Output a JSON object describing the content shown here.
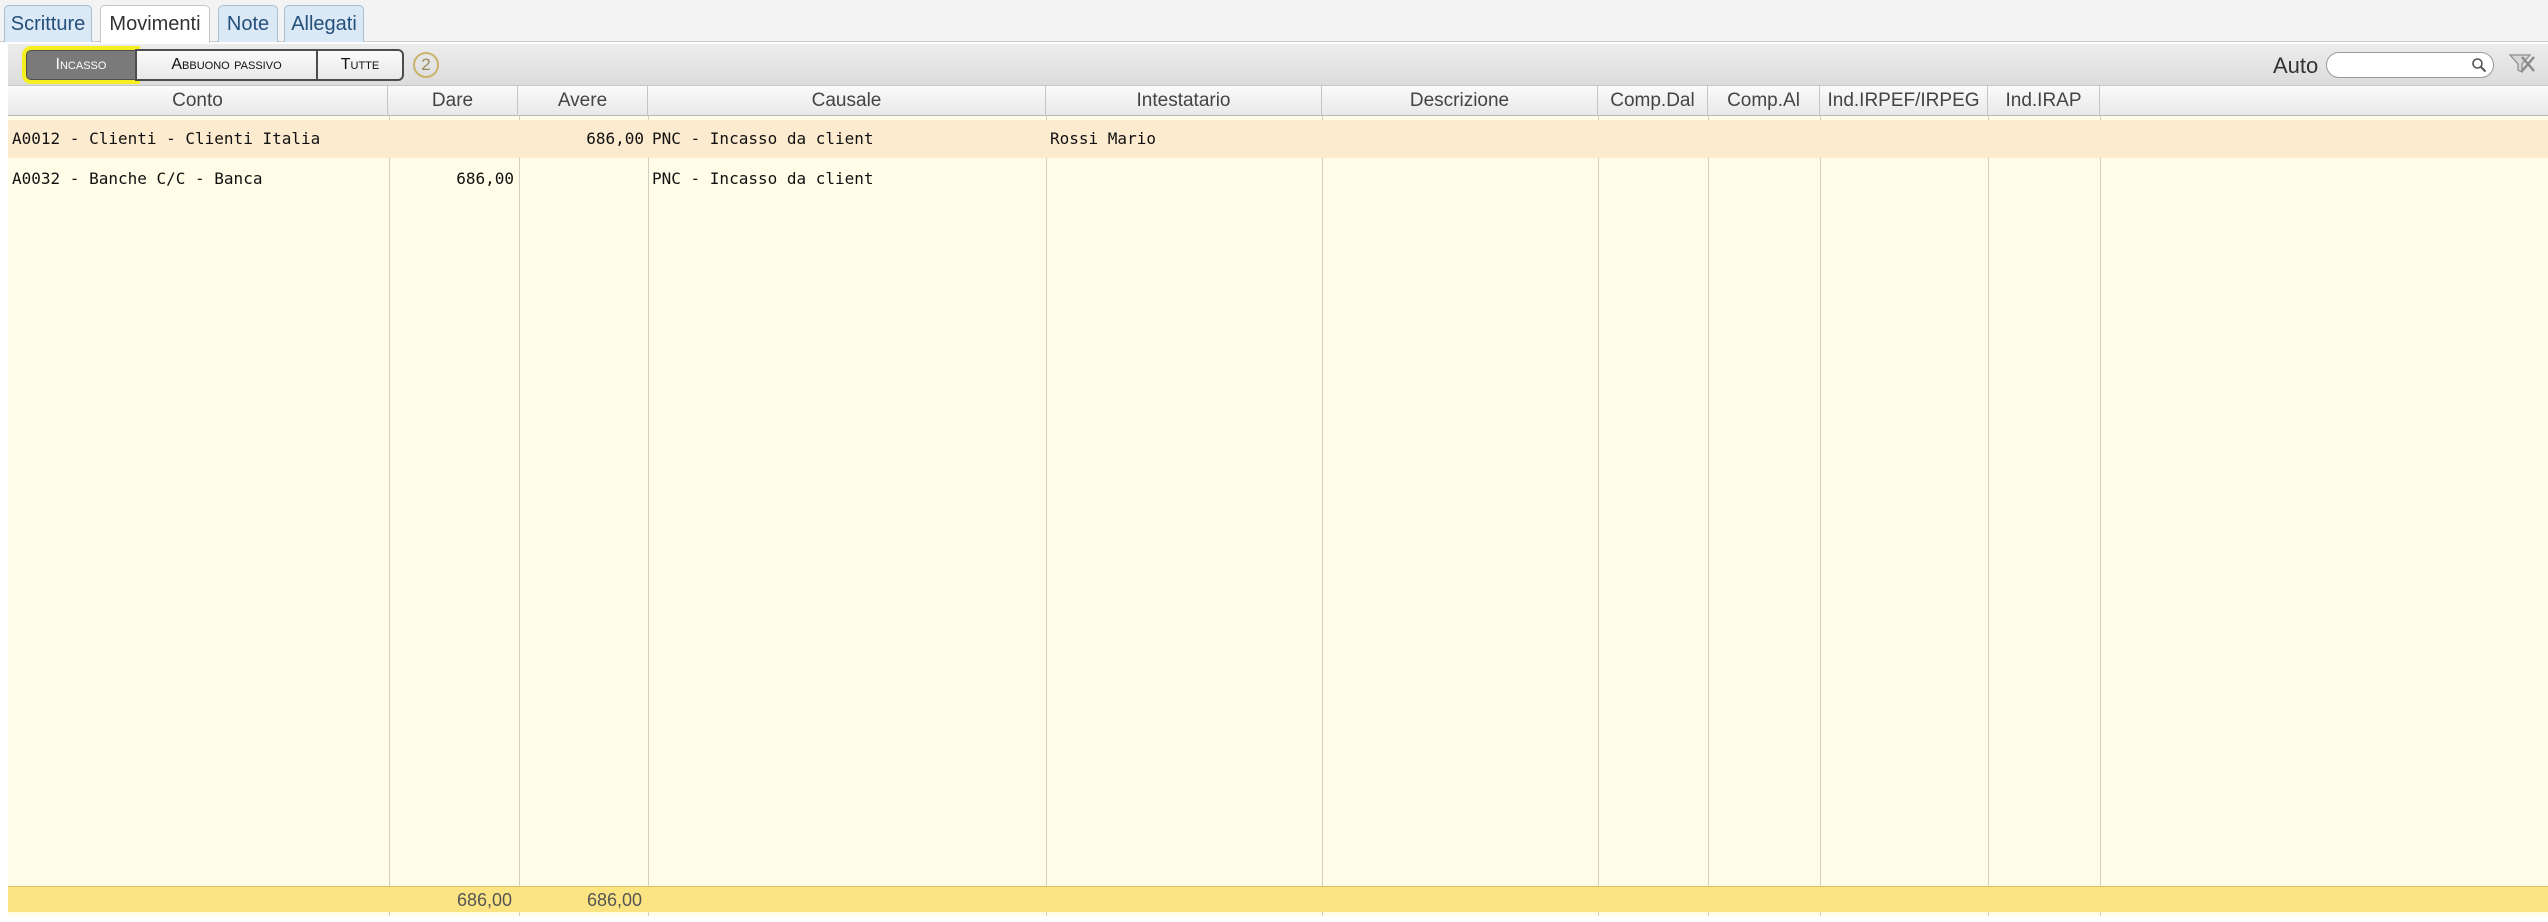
{
  "tabs": [
    {
      "label": "Scritture",
      "active": false
    },
    {
      "label": "Movimenti",
      "active": true
    },
    {
      "label": "Note",
      "active": false
    },
    {
      "label": "Allegati",
      "active": false
    }
  ],
  "toolbar": {
    "filters": [
      {
        "label": "Incasso",
        "selected": true
      },
      {
        "label": "Abbuono passivo",
        "selected": false
      },
      {
        "label": "Tutte",
        "selected": false
      }
    ],
    "count": "2",
    "auto_label": "Auto",
    "search_value": "",
    "search_icon": "search-icon",
    "clear_icon": "clear-filter-icon"
  },
  "table": {
    "columns": [
      "Conto",
      "Dare",
      "Avere",
      "Causale",
      "Intestatario",
      "Descrizione",
      "Comp.Dal",
      "Comp.Al",
      "Ind.IRPEF/IRPEG",
      "Ind.IRAP"
    ],
    "rows": [
      {
        "conto": "A0012 - Clienti - Clienti Italia",
        "dare": "",
        "avere": "686,00",
        "causale": "PNC - Incasso da client",
        "intestatario": "Rossi Mario",
        "descrizione": "",
        "comp_dal": "",
        "comp_al": "",
        "ind_irpef": "",
        "ind_irap": ""
      },
      {
        "conto": "A0032 - Banche C/C - Banca",
        "dare": "686,00",
        "avere": "",
        "causale": "PNC - Incasso da client",
        "intestatario": "",
        "descrizione": "",
        "comp_dal": "",
        "comp_al": "",
        "ind_irpef": "",
        "ind_irap": ""
      }
    ],
    "totals": {
      "dare": "686,00",
      "avere": "686,00"
    }
  },
  "colors": {
    "grid_background": "#fffde8",
    "selected_row": "#fdebd0",
    "totals_row": "#fde483",
    "selected_filter_outline": "#f5ef20"
  }
}
